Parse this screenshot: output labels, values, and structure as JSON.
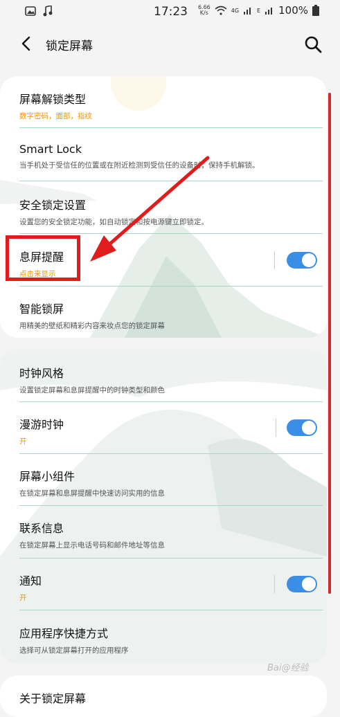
{
  "status_bar": {
    "time": "17:23",
    "net_speed_value": "6.66",
    "net_speed_unit": "K/s",
    "network": "4G",
    "network_e": "E",
    "battery": "100%"
  },
  "app_bar": {
    "title": "锁定屏幕"
  },
  "section1": [
    {
      "title": "屏幕解锁类型",
      "subtitle": "数字密码，面部，指纹",
      "subtitle_color": "#f29400",
      "toggle": false
    },
    {
      "title": "Smart Lock",
      "subtitle": "当手机处于受信任的位置或在附近检测到受信任的设备时，保持手机解锁。",
      "toggle": false
    },
    {
      "title": "安全锁定设置",
      "subtitle": "设置您的安全锁定功能，如自动锁定和按电源键立即锁定。",
      "toggle": false
    },
    {
      "title": "息屏提醒",
      "subtitle": "点击来显示",
      "subtitle_color": "#f29400",
      "toggle": true,
      "toggle_on": true
    },
    {
      "title": "智能锁屏",
      "subtitle": "用精美的壁纸和精彩内容来妆点您的锁定屏幕",
      "toggle": false
    }
  ],
  "section2": [
    {
      "title": "时钟风格",
      "subtitle": "设置锁定屏幕和息屏提醒中的时钟类型和颜色",
      "toggle": false
    },
    {
      "title": "漫游时钟",
      "subtitle": "开",
      "subtitle_color": "#f29400",
      "toggle": true,
      "toggle_on": true
    },
    {
      "title": "屏幕小组件",
      "subtitle": "在锁定屏幕和息屏提醒中快速访问实用的信息",
      "toggle": false
    },
    {
      "title": "联系信息",
      "subtitle": "在锁定屏幕上显示电话号码和邮件地址等信息",
      "toggle": false
    },
    {
      "title": "通知",
      "subtitle": "开",
      "subtitle_color": "#f29400",
      "toggle": true,
      "toggle_on": true
    },
    {
      "title": "应用程序快捷方式",
      "subtitle": "选择可从锁定屏幕打开的应用程序",
      "toggle": false
    }
  ],
  "section3": [
    {
      "title": "关于锁定屏幕"
    }
  ],
  "watermark": "Bai@经验",
  "colors": {
    "accent_orange": "#f29400",
    "toggle_blue": "#3a8ee6",
    "annotation_red": "#e11c1c",
    "divider_green": "#a9d7c6"
  }
}
